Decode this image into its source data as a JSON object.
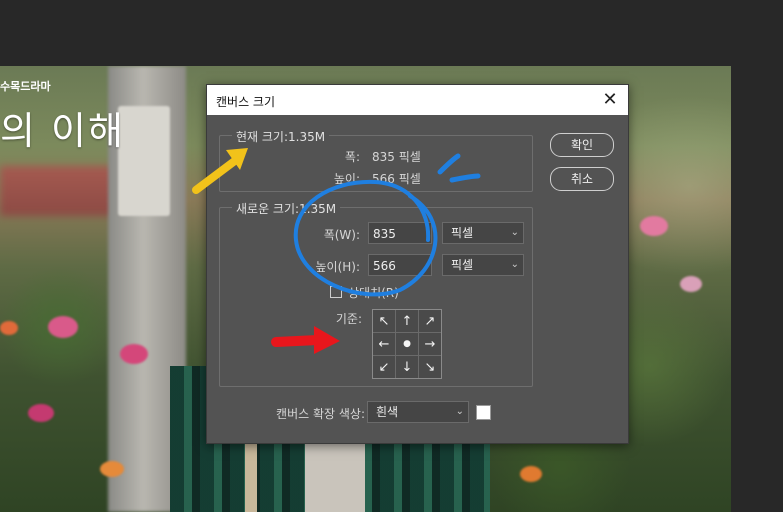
{
  "background": {
    "logo_text": "수목드라마",
    "title_text": "의 이해"
  },
  "dialog": {
    "title": "캔버스 크기",
    "close_icon": "close-icon",
    "current_size": {
      "label": "현재 크기:1.35M",
      "width_label": "폭:",
      "width_value": "835 픽셀",
      "height_label": "높이:",
      "height_value": "566 픽셀"
    },
    "new_size": {
      "label": "새로운 크기:1.35M",
      "width_label": "폭(W):",
      "width_value": "835",
      "width_unit": "픽셀",
      "height_label": "높이(H):",
      "height_value": "566",
      "height_unit": "픽셀",
      "relative_label": "상대치(R)",
      "anchor_label": "기준:",
      "anchor_arrows": [
        "↖",
        "↑",
        "↗",
        "←",
        "●",
        "→",
        "↙",
        "↓",
        "↘"
      ]
    },
    "extension_color_label": "캔버스 확장 색상:",
    "extension_color_value": "흰색",
    "extension_color_swatch": "#ffffff",
    "ok_label": "확인",
    "cancel_label": "취소"
  },
  "annotation_colors": {
    "yellow_arrow": "#f2c21a",
    "blue_circle": "#1f7fe0",
    "red_arrow": "#e8161c"
  }
}
